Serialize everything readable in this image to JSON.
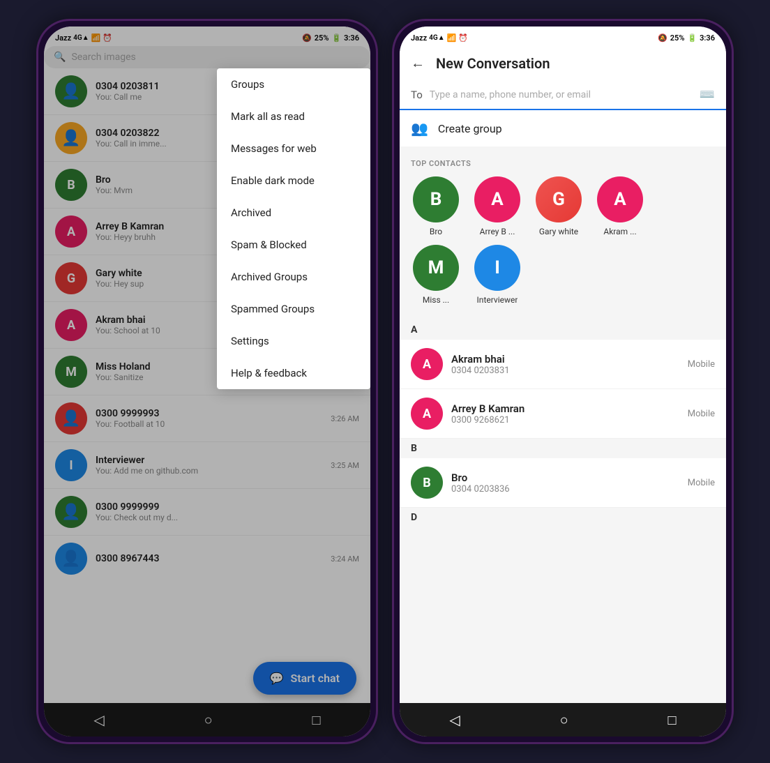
{
  "left_phone": {
    "status_bar": {
      "carrier": "Jazz",
      "signal": "4G",
      "wifi": "WiFi",
      "time": "3:36",
      "battery": "25%"
    },
    "search_placeholder": "Search images",
    "conversations": [
      {
        "id": 1,
        "name": "0304 0203811",
        "preview": "You: Call me",
        "time": "",
        "avatar_letter": "👤",
        "avatar_color": "bg-green",
        "is_icon": true
      },
      {
        "id": 2,
        "name": "0304 0203822",
        "preview": "You: Call in imme...",
        "time": "",
        "avatar_letter": "👤",
        "avatar_color": "bg-yellow",
        "is_icon": true
      },
      {
        "id": 3,
        "name": "Bro",
        "preview": "You: Mvm",
        "time": "",
        "avatar_letter": "B",
        "avatar_color": "bg-green"
      },
      {
        "id": 4,
        "name": "Arrey B Kamran",
        "preview": "You: Heyy bruhh",
        "time": "",
        "avatar_letter": "A",
        "avatar_color": "bg-pink"
      },
      {
        "id": 5,
        "name": "Gary white",
        "preview": "You: Hey sup",
        "time": "",
        "avatar_letter": "G",
        "avatar_color": "bg-red-orange"
      },
      {
        "id": 6,
        "name": "Akram bhai",
        "preview": "You: School at 10",
        "time": "",
        "avatar_letter": "A",
        "avatar_color": "bg-pink"
      },
      {
        "id": 7,
        "name": "Miss Holand",
        "preview": "You: Sanitize",
        "time": "",
        "avatar_letter": "M",
        "avatar_color": "bg-green"
      },
      {
        "id": 8,
        "name": "0300 9999993",
        "preview": "You: Football at 10",
        "time": "3:26 AM",
        "avatar_letter": "👤",
        "avatar_color": "bg-red-orange",
        "is_icon": true
      },
      {
        "id": 9,
        "name": "Interviewer",
        "preview": "You: Add me on github.com",
        "time": "3:25 AM",
        "avatar_letter": "I",
        "avatar_color": "bg-blue"
      },
      {
        "id": 10,
        "name": "0300 9999999",
        "preview": "You: Check out my d...",
        "time": "",
        "avatar_letter": "👤",
        "avatar_color": "bg-green",
        "is_icon": true
      },
      {
        "id": 11,
        "name": "0300 8967443",
        "preview": "",
        "time": "3:24 AM",
        "avatar_letter": "👤",
        "avatar_color": "bg-blue",
        "is_icon": true
      }
    ],
    "menu_items": [
      "Groups",
      "Mark all as read",
      "Messages for web",
      "Enable dark mode",
      "Archived",
      "Spam & Blocked",
      "Archived Groups",
      "Spammed Groups",
      "Settings",
      "Help & feedback"
    ],
    "fab_label": "Start chat",
    "fab_icon": "💬"
  },
  "right_phone": {
    "status_bar": {
      "carrier": "Jazz",
      "signal": "4G",
      "wifi": "WiFi",
      "time": "3:36",
      "battery": "25%"
    },
    "title": "New Conversation",
    "to_placeholder": "Type a name, phone number, or email",
    "create_group_label": "Create group",
    "top_contacts_label": "TOP CONTACTS",
    "top_contacts": [
      {
        "letter": "B",
        "name": "Bro",
        "color": "bg-green"
      },
      {
        "letter": "A",
        "name": "Arrey B ...",
        "color": "bg-pink"
      },
      {
        "letter": "G",
        "name": "Gary white",
        "color": "bg-red-orange"
      },
      {
        "letter": "A",
        "name": "Akram ...",
        "color": "bg-pink"
      },
      {
        "letter": "M",
        "name": "Miss ...",
        "color": "bg-green"
      },
      {
        "letter": "I",
        "name": "Interviewer",
        "color": "bg-blue"
      }
    ],
    "contact_sections": [
      {
        "letter": "A",
        "contacts": [
          {
            "name": "Akram bhai",
            "phone": "0304 0203831",
            "type": "Mobile",
            "letter": "A",
            "color": "bg-pink"
          },
          {
            "name": "Arrey B Kamran",
            "phone": "0300 9268621",
            "type": "Mobile",
            "letter": "A",
            "color": "bg-pink"
          }
        ]
      },
      {
        "letter": "B",
        "contacts": [
          {
            "name": "Bro",
            "phone": "0304 0203836",
            "type": "Mobile",
            "letter": "B",
            "color": "bg-green"
          }
        ]
      },
      {
        "letter": "D",
        "contacts": []
      }
    ]
  }
}
